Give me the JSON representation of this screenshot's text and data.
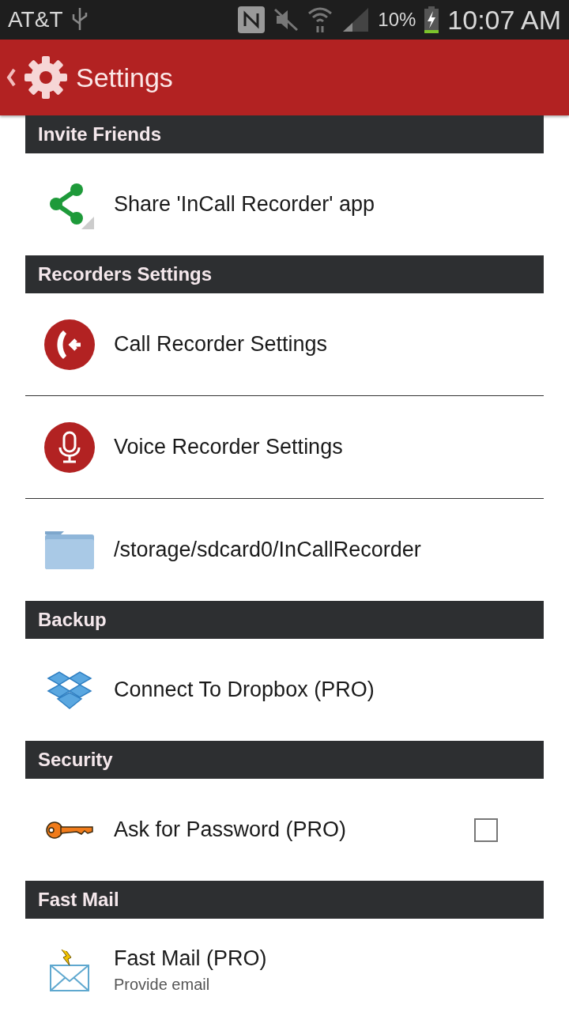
{
  "status_bar": {
    "carrier": "AT&T",
    "battery": "10%",
    "time": "10:07 AM"
  },
  "app_bar": {
    "title": "Settings"
  },
  "sections": [
    {
      "title": "Invite Friends",
      "items": [
        {
          "kind": "plain",
          "label": "Share 'InCall Recorder' app"
        }
      ]
    },
    {
      "title": "Recorders Settings",
      "items": [
        {
          "kind": "plain",
          "label": "Call Recorder Settings"
        },
        {
          "kind": "plain",
          "label": "Voice Recorder Settings"
        },
        {
          "kind": "plain",
          "label": "/storage/sdcard0/InCallRecorder"
        }
      ]
    },
    {
      "title": "Backup",
      "items": [
        {
          "kind": "plain",
          "label": "Connect To Dropbox (PRO)"
        }
      ]
    },
    {
      "title": "Security",
      "items": [
        {
          "kind": "checkbox",
          "label": "Ask for Password (PRO)",
          "checked": false
        }
      ]
    },
    {
      "title": "Fast Mail",
      "items": [
        {
          "kind": "plain",
          "label": "Fast Mail (PRO)",
          "subtitle": "Provide email"
        }
      ]
    }
  ]
}
